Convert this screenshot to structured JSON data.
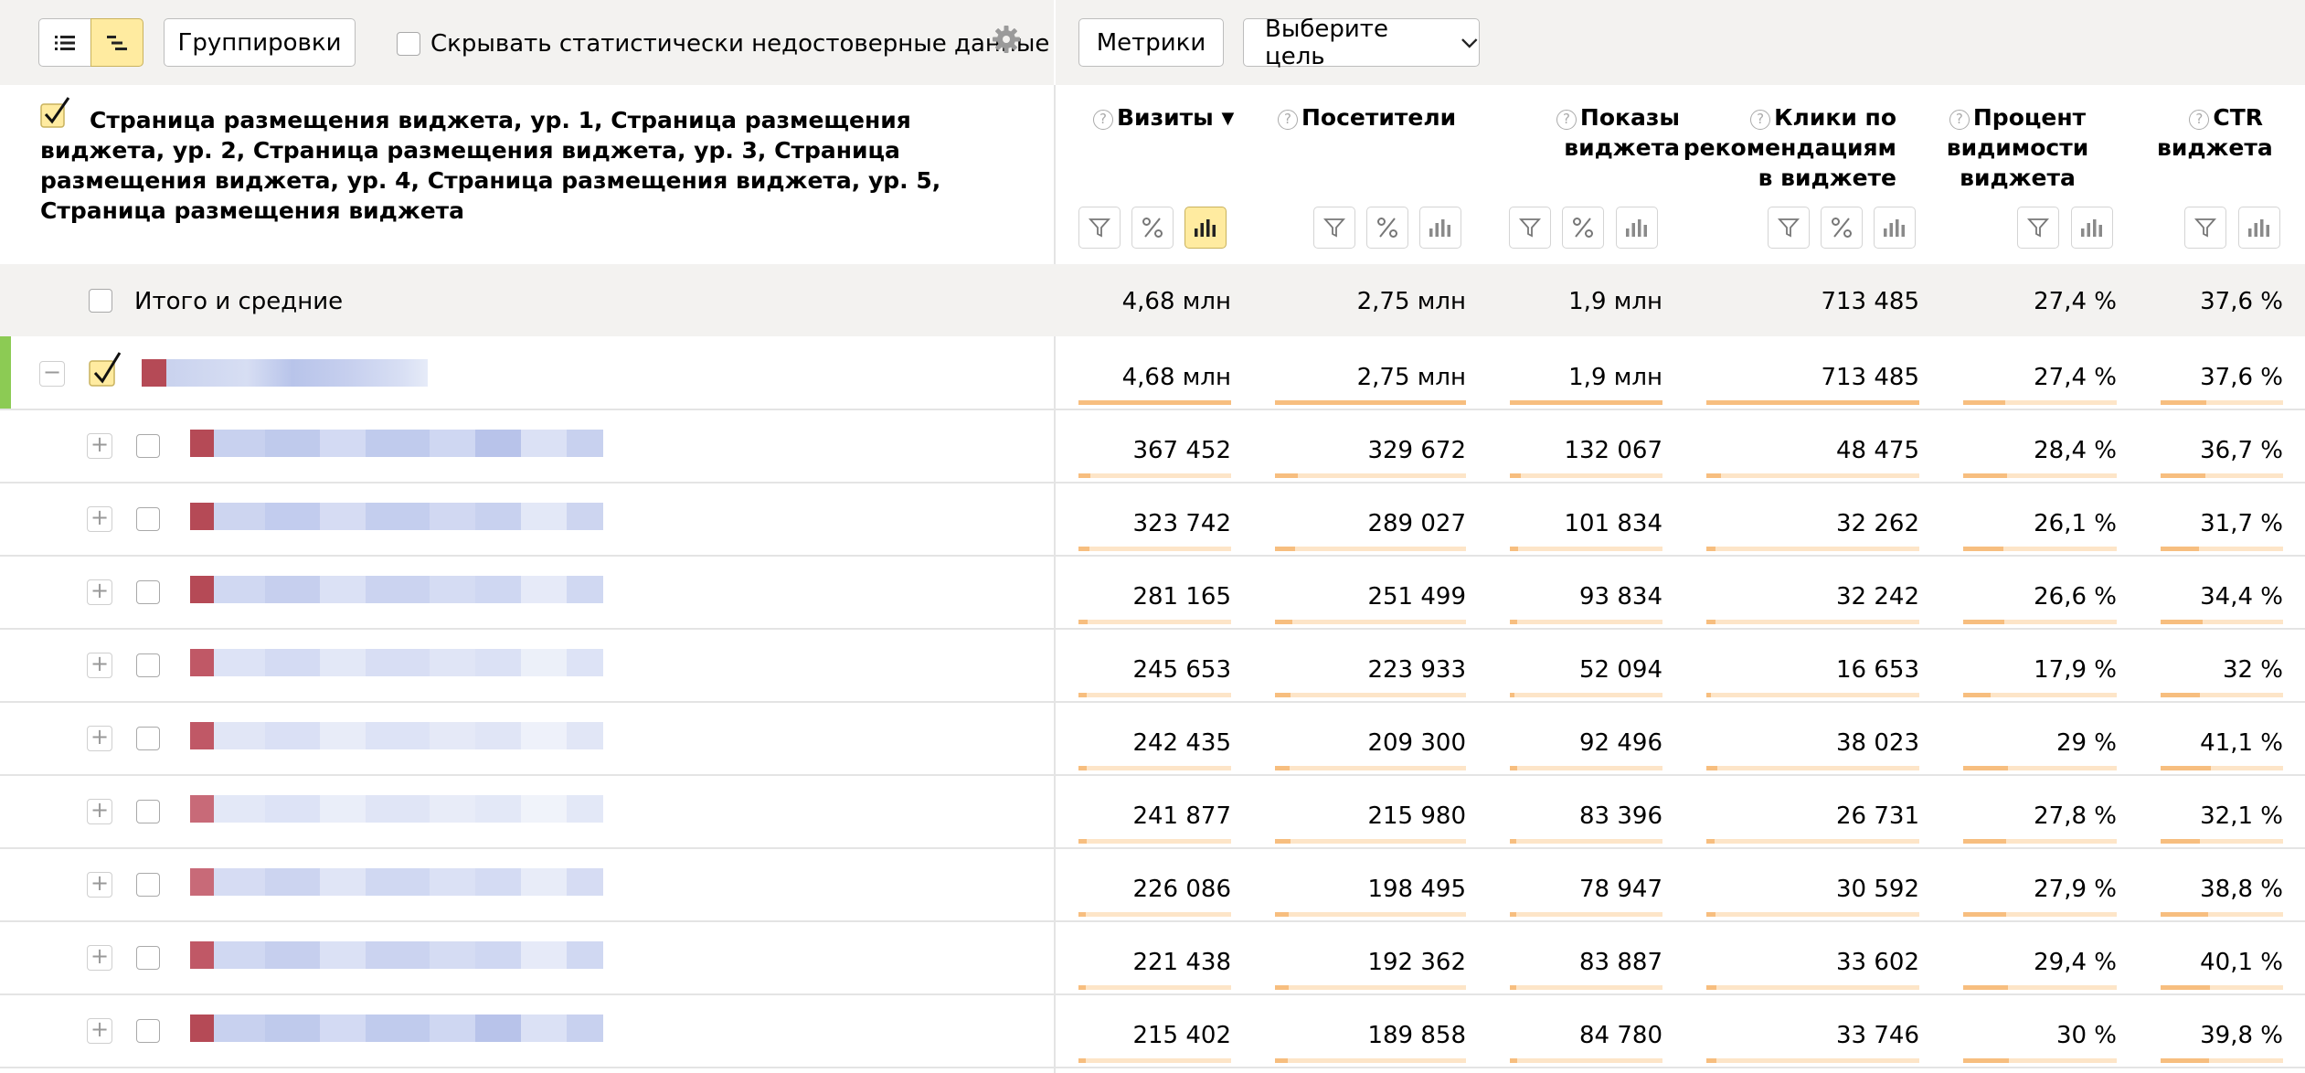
{
  "toolbar": {
    "groupings_label": "Группировки",
    "hide_unreliable_label": "Скрывать статистически недостоверные данные",
    "metrics_label": "Метрики",
    "goal_select_label": "Выберите цель"
  },
  "header": {
    "dimension_title": "Страница размещения виджета, ур. 1, Страница размещения виджета, ур. 2, Страница размещения виджета, ур. 3, Страница размещения виджета, ур. 4, Страница размещения виджета, ур. 5, Страница размещения виджета",
    "sort_indicator": "▼",
    "help_glyph": "?",
    "columns": [
      {
        "label": "Визиты",
        "lines": [
          "Визиты"
        ]
      },
      {
        "label": "Посетители",
        "lines": [
          "Посетители"
        ]
      },
      {
        "label": "Показы виджета",
        "lines": [
          "Показы",
          "виджета"
        ]
      },
      {
        "label": "Клики по рекомендациям в виджете",
        "lines": [
          "Клики по",
          "рекомендациям",
          "в виджете"
        ]
      },
      {
        "label": "Процент видимости виджета",
        "lines": [
          "Процент",
          "видимости",
          "виджета"
        ]
      },
      {
        "label": "CTR виджета",
        "lines": [
          "CTR",
          "виджета"
        ]
      }
    ]
  },
  "totals": {
    "label": "Итого и средние",
    "values": [
      "4,68 млн",
      "2,75 млн",
      "1,9 млн",
      "713 485",
      "27,4 %",
      "37,6 %"
    ]
  },
  "group_row": {
    "collapse_glyph": "−",
    "values": [
      "4,68 млн",
      "2,75 млн",
      "1,9 млн",
      "713 485",
      "27,4 %",
      "37,6 %"
    ],
    "bar_fractions": [
      1,
      1,
      1,
      1,
      0.274,
      0.376
    ]
  },
  "rows": [
    {
      "values": [
        "367 452",
        "329 672",
        "132 067",
        "48 475",
        "28,4 %",
        "36,7 %"
      ],
      "bar_fractions": [
        0.079,
        0.12,
        0.069,
        0.068,
        0.284,
        0.367
      ]
    },
    {
      "values": [
        "323 742",
        "289 027",
        "101 834",
        "32 262",
        "26,1 %",
        "31,7 %"
      ],
      "bar_fractions": [
        0.069,
        0.105,
        0.054,
        0.045,
        0.261,
        0.317
      ]
    },
    {
      "values": [
        "281 165",
        "251 499",
        "93 834",
        "32 242",
        "26,6 %",
        "34,4 %"
      ],
      "bar_fractions": [
        0.06,
        0.091,
        0.049,
        0.045,
        0.266,
        0.344
      ]
    },
    {
      "values": [
        "245 653",
        "223 933",
        "52 094",
        "16 653",
        "17,9 %",
        "32 %"
      ],
      "bar_fractions": [
        0.052,
        0.081,
        0.027,
        0.023,
        0.179,
        0.32
      ]
    },
    {
      "values": [
        "242 435",
        "209 300",
        "92 496",
        "38 023",
        "29 %",
        "41,1 %"
      ],
      "bar_fractions": [
        0.052,
        0.076,
        0.049,
        0.053,
        0.29,
        0.411
      ]
    },
    {
      "values": [
        "241 877",
        "215 980",
        "83 396",
        "26 731",
        "27,8 %",
        "32,1 %"
      ],
      "bar_fractions": [
        0.052,
        0.079,
        0.044,
        0.037,
        0.278,
        0.321
      ]
    },
    {
      "values": [
        "226 086",
        "198 495",
        "78 947",
        "30 592",
        "27,9 %",
        "38,8 %"
      ],
      "bar_fractions": [
        0.048,
        0.072,
        0.042,
        0.043,
        0.279,
        0.388
      ]
    },
    {
      "values": [
        "221 438",
        "192 362",
        "83 887",
        "33 602",
        "29,4 %",
        "40,1 %"
      ],
      "bar_fractions": [
        0.047,
        0.07,
        0.044,
        0.047,
        0.294,
        0.401
      ]
    },
    {
      "values": [
        "215 402",
        "189 858",
        "84 780",
        "33 746",
        "30 %",
        "39,8 %"
      ],
      "bar_fractions": [
        0.046,
        0.069,
        0.045,
        0.047,
        0.3,
        0.398
      ]
    }
  ],
  "row_expand_glyph": "+",
  "colors": {
    "toolbar_bg": "#f3f2f0",
    "active_yellow": "#ffeba0",
    "bar_track": "#fde5c8",
    "bar_fill": "#f7be7f",
    "group_accent": "#8ccb54"
  }
}
